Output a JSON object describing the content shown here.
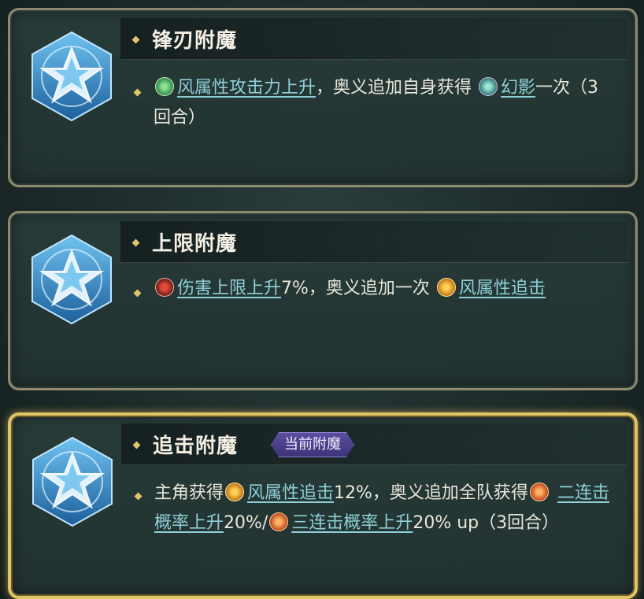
{
  "cards": [
    {
      "title": "锋刃附魔",
      "desc": {
        "icon1": "wind-attack-icon",
        "link1": "风属性攻击力上升",
        "text1": "，奥义追加自身获得",
        "icon2": "phantom-icon",
        "link2": "幻影",
        "text2": "一次（3回合）"
      }
    },
    {
      "title": "上限附魔",
      "desc": {
        "icon1": "damage-cap-icon",
        "link1": "伤害上限上升",
        "text1": "7%，奥义追加一次",
        "icon2": "wind-chase-icon",
        "link2": "风属性追击"
      }
    },
    {
      "title": "追击附魔",
      "badge": "当前附魔",
      "desc": {
        "text0": "主角获得",
        "icon1": "wind-chase-icon",
        "link1": "风属性追击",
        "text1": "12%，奥义追加全队获得",
        "icon2": "double-attack-icon",
        "link2": "二连击概率上升",
        "text2": "20%/",
        "icon3": "triple-attack-icon",
        "link3": "三连击概率上升",
        "text3": "20% up（3回合）"
      }
    }
  ],
  "colors": {
    "gold_border": "#e0c466",
    "link": "#8fd0d8",
    "badge": "#4a3f8c"
  }
}
